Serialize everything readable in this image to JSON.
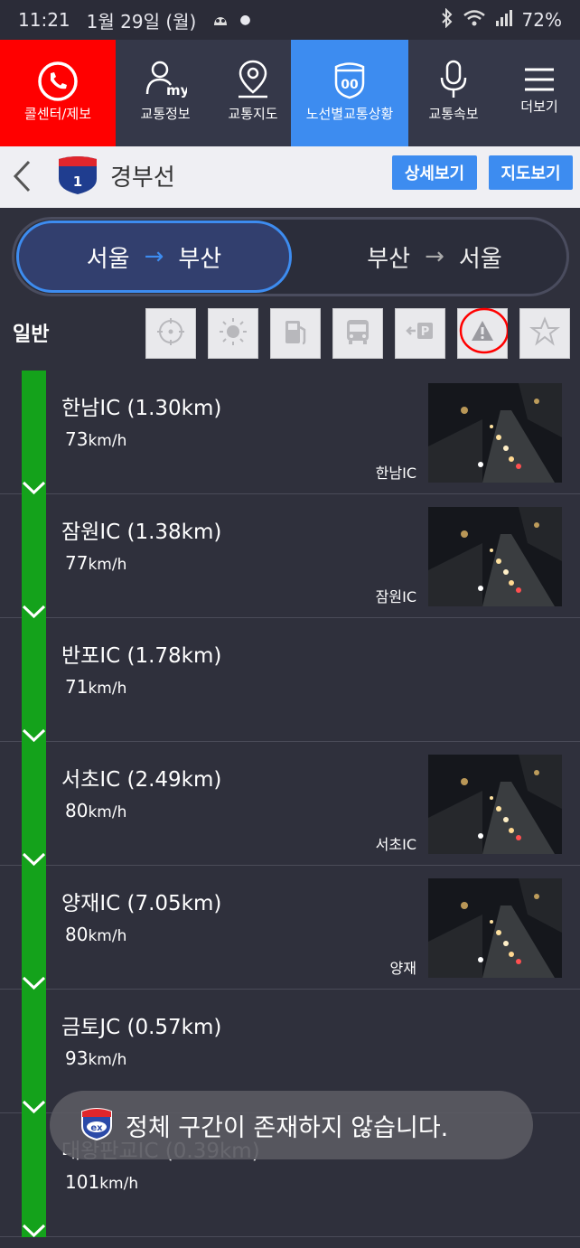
{
  "status_bar": {
    "time": "11:21",
    "date": "1월 29일 (월)",
    "battery": "72%"
  },
  "nav": {
    "call_center": "콜센터/제보",
    "traffic_info": "교통정보",
    "traffic_map": "교통지도",
    "route_traffic": "노선별교통상황",
    "traffic_speed": "교통속보",
    "more": "더보기",
    "route_icon_label": "00"
  },
  "route": {
    "shield_number": "1",
    "name": "경부선",
    "detail_button": "상세보기",
    "map_button": "지도보기"
  },
  "direction": {
    "active": {
      "from": "서울",
      "to": "부산"
    },
    "inactive": {
      "from": "부산",
      "to": "서울"
    },
    "arrow": "→"
  },
  "filter": {
    "label": "일반",
    "icons": [
      "target-icon",
      "sun-icon",
      "fuel-icon",
      "bus-icon",
      "parking-icon",
      "warning-icon",
      "star-icon"
    ],
    "highlight_color": "#ff0000"
  },
  "sections": [
    {
      "title": "한남IC (1.30km)",
      "speed": "73",
      "unit": "km/h",
      "cam_label": "한남IC",
      "has_cam": true
    },
    {
      "title": "잠원IC (1.38km)",
      "speed": "77",
      "unit": "km/h",
      "cam_label": "잠원IC",
      "has_cam": true
    },
    {
      "title": "반포IC (1.78km)",
      "speed": "71",
      "unit": "km/h",
      "cam_label": "",
      "has_cam": false
    },
    {
      "title": "서초IC (2.49km)",
      "speed": "80",
      "unit": "km/h",
      "cam_label": "서초IC",
      "has_cam": true
    },
    {
      "title": "양재IC (7.05km)",
      "speed": "80",
      "unit": "km/h",
      "cam_label": "양재",
      "has_cam": true
    },
    {
      "title": "금토JC (0.57km)",
      "speed": "93",
      "unit": "km/h",
      "cam_label": "",
      "has_cam": false
    },
    {
      "title": "대왕판교IC (0.39km)",
      "speed": "101",
      "unit": "km/h",
      "cam_label": "",
      "has_cam": false
    }
  ],
  "toast": {
    "message": "정체 구간이 존재하지 않습니다.",
    "logo_text": "ex"
  },
  "colors": {
    "flow_green": "#14a21b",
    "accent_blue": "#3d8cf0",
    "call_red": "#ff0000",
    "background": "#2f303c"
  }
}
